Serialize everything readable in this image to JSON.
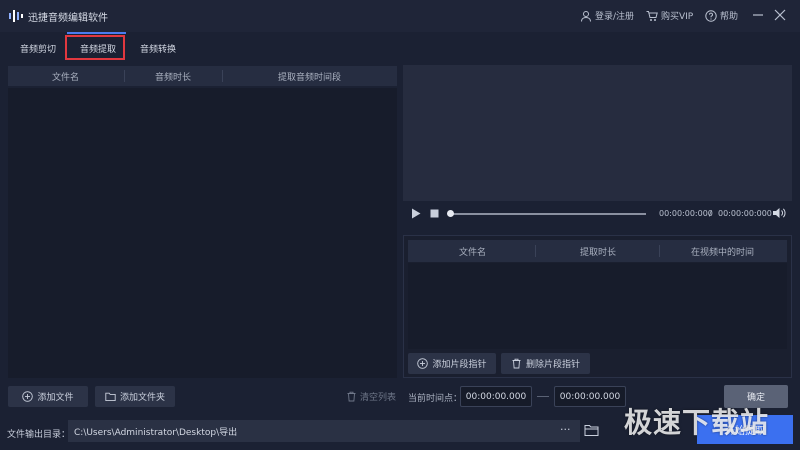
{
  "app": {
    "title": "迅捷音频编辑软件",
    "login_label": "登录/注册",
    "vip_label": "购买VIP",
    "help_label": "帮助"
  },
  "tabs": [
    {
      "label": "音频剪切",
      "active": false
    },
    {
      "label": "音频提取",
      "active": true
    },
    {
      "label": "音频转换",
      "active": false
    }
  ],
  "file_table": {
    "columns": [
      "文件名",
      "音频时长",
      "提取音频时间段"
    ],
    "rows": []
  },
  "left_actions": {
    "add_file": "添加文件",
    "add_folder": "添加文件夹",
    "clear_list": "清空列表"
  },
  "player": {
    "current_time": "00:00:00:000",
    "separator": "/",
    "total_time": "00:00:00:000",
    "progress": 0
  },
  "segment_table": {
    "columns": [
      "文件名",
      "提取时长",
      "在视频中的时间"
    ],
    "rows": [],
    "add_pointer": "添加片段指针",
    "delete_pointer": "删除片段指针"
  },
  "time_point": {
    "label": "当前时间点：",
    "start": "00:00:00.000",
    "end": "00:00:00.000",
    "confirm": "确定"
  },
  "output": {
    "label": "文件输出目录：",
    "path": "C:\\Users\\Administrator\\Desktop\\导出",
    "more": "···",
    "start_button": "开始提取"
  },
  "watermark": "极速下载站",
  "colors": {
    "accent": "#3b70f0",
    "active_tab_highlight": "#e2383f",
    "background": "#1b2133"
  }
}
